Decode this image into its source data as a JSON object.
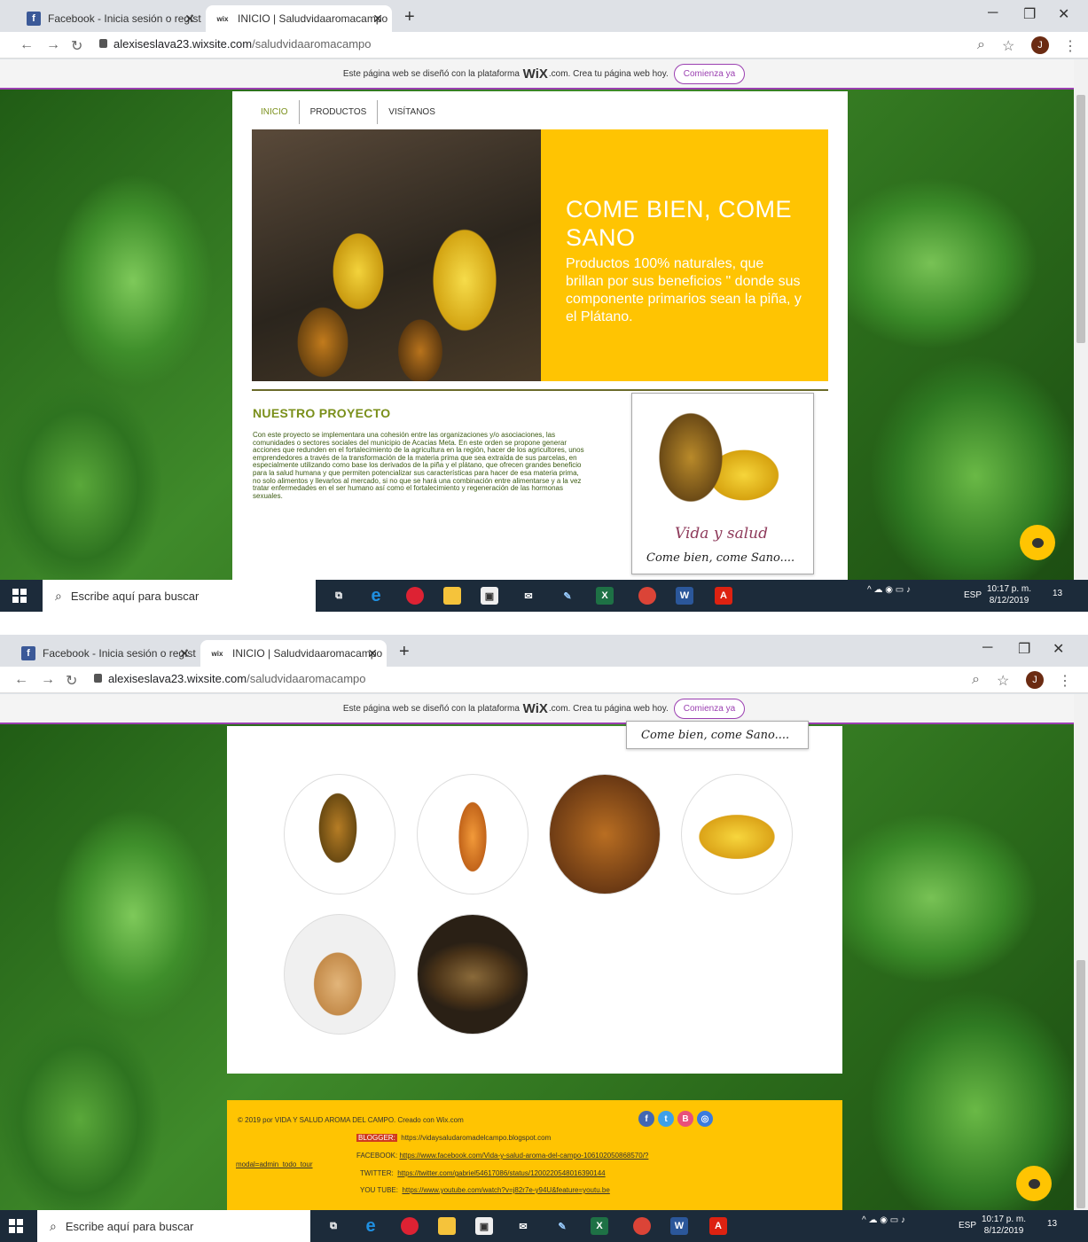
{
  "browser": {
    "tabs": [
      {
        "label": "Facebook - Inicia sesión o regíst",
        "favicon": "facebook-icon"
      },
      {
        "label": "INICIO | Saludvidaaromacampo",
        "favicon": "wix-icon",
        "favicon_text": "wix"
      }
    ],
    "close_glyph": "✕",
    "new_tab_glyph": "+",
    "url_domain": "alexiseslava23.wixsite.com",
    "url_path": "/saludvidaaromacampo",
    "avatar_letter": "J"
  },
  "wix_banner": {
    "text_before": "Este página web se diseñó con la plataforma",
    "brand": "WiX",
    "text_after": ".com. Crea tu página web hoy.",
    "button": "Comienza ya"
  },
  "site": {
    "nav": [
      "INICIO",
      "PRODUCTOS",
      "VISÍTANOS"
    ],
    "hero_title": "COME BIEN, COME SANO",
    "hero_text": "Productos 100% naturales,  que brillan por sus beneficios \"  donde sus componente primarios sean la piña, y el Plátano.",
    "project_title": "NUESTRO PROYECTO",
    "project_text": "Con este proyecto se implementara una cohesión entre las organizaciones y/o asociaciones, las comunidades o sectores sociales del municipio de Acacias Meta. En este orden se propone generar acciones que redunden en el fortalecimiento de la agricultura en la región, hacer de los agricultores, unos emprendedores a través de la transformación de la materia prima que sea extraída de sus parcelas, en especialmente utilizando como base los derivados   de la piña y el plátano, que ofrecen grandes beneficio para la salud humana y que permiten potencializar sus características para hacer de esa materia prima, no solo alimentos y llevarlos al mercado, si no que se hará una combinación entre alimentarse y a la vez tratar enfermedades en el ser humano así como el fortalecimiento y regeneración de las hormonas sexuales.",
    "card_script_1": "Vida y salud",
    "card_script_2": "Come bien, come Sano....",
    "products": [
      "pineapple",
      "juice-bottle",
      "packaged-cake",
      "banana",
      "smoothie",
      "bread"
    ]
  },
  "footer": {
    "copyright": "© 2019 por VIDA Y SALUD  AROMA DEL CAMPO. Creado con Wix.com",
    "modal_link": "modal=admin_todo_tour",
    "blogger_label": "BLOGGER:",
    "blogger_url": "https://vidaysaludaromadelcampo.blogspot.com",
    "facebook_label": "FACEBOOK:",
    "facebook_url": "https://www.facebook.com/Vida-y-salud-aroma-del-campo-106102050868570/?",
    "twitter_label": "TWITTER:",
    "twitter_url": "https://twitter.com/gabriel54617086/status/1200220548016390144",
    "youtube_label": "YOU TUBE:",
    "youtube_url": "https://www.youtube.com/watch?v=j82r7e-y94U&feature=youtu.be"
  },
  "taskbar": {
    "search_placeholder": "Escribe aquí para buscar",
    "language": "ESP",
    "time": "10:17 p. m.",
    "date": "8/12/2019",
    "notifications": "13"
  },
  "colors": {
    "accent_yellow": "#ffc402",
    "wix_purple": "#9b3fb1",
    "nav_green": "#7a8f1a"
  }
}
